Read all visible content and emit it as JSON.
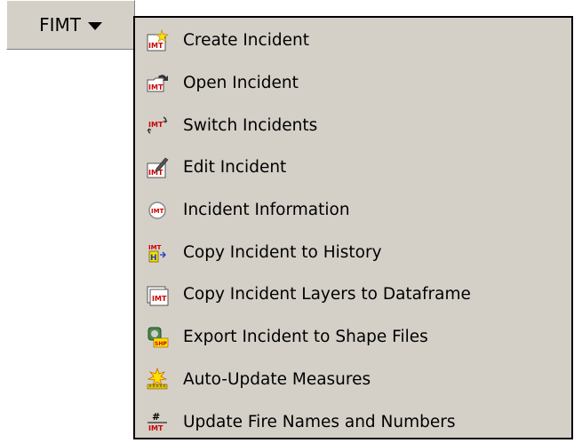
{
  "toolbar": {
    "menu_button_label": "FIMT"
  },
  "menu": {
    "items": [
      {
        "label": "Create Incident",
        "icon": "create-incident-icon"
      },
      {
        "label": "Open Incident",
        "icon": "open-incident-icon"
      },
      {
        "label": "Switch Incidents",
        "icon": "switch-incidents-icon"
      },
      {
        "label": "Edit Incident",
        "icon": "edit-incident-icon"
      },
      {
        "label": "Incident Information",
        "icon": "incident-information-icon"
      },
      {
        "label": "Copy Incident to History",
        "icon": "copy-to-history-icon"
      },
      {
        "label": "Copy Incident Layers to Dataframe",
        "icon": "copy-layers-icon"
      },
      {
        "label": "Export Incident to Shape Files",
        "icon": "export-shapefile-icon"
      },
      {
        "label": "Auto-Update Measures",
        "icon": "auto-update-icon"
      },
      {
        "label": "Update Fire Names and Numbers",
        "icon": "fire-numbers-icon"
      }
    ]
  },
  "colors": {
    "menu_background": "#d4d0c8",
    "imt_red": "#cc0000",
    "menu_border": "#000000"
  }
}
